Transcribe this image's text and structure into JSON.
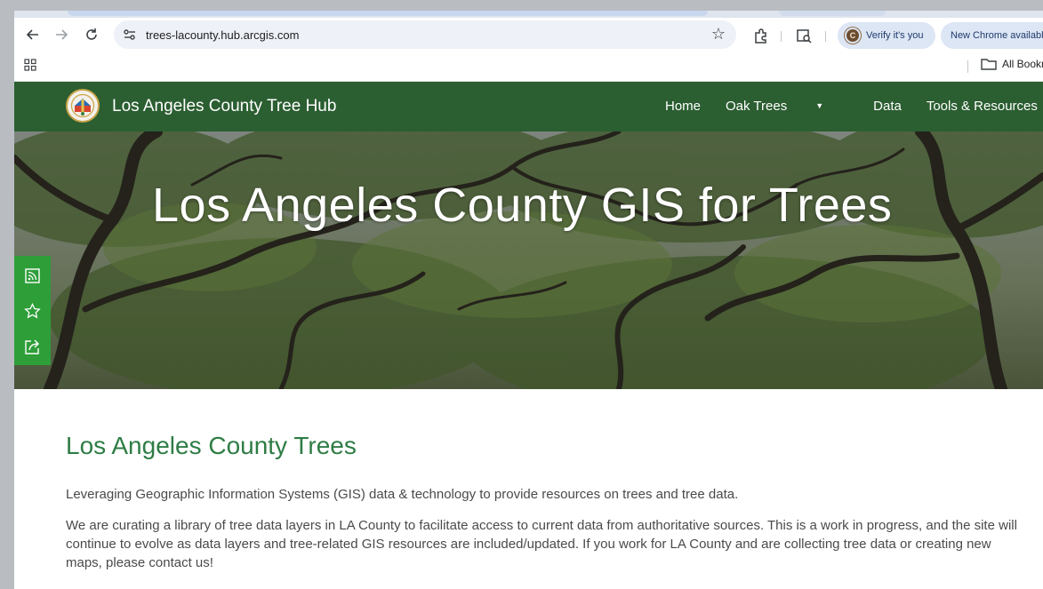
{
  "browser": {
    "url": "trees-lacounty.hub.arcgis.com",
    "verify_chip": "Verify it's you",
    "verify_icon_letter": "C",
    "update_chip": "New Chrome availabl",
    "bookmarks_label": "All Bookm"
  },
  "site": {
    "title": "Los Angeles County Tree Hub",
    "nav": {
      "home": "Home",
      "oak_trees": "Oak Trees",
      "data": "Data",
      "tools": "Tools & Resources"
    },
    "hero_title": "Los Angeles County GIS for Trees"
  },
  "content": {
    "heading": "Los Angeles County Trees",
    "intro": "Leveraging Geographic Information Systems (GIS) data & technology to provide resources on trees and tree data.",
    "body": "We are curating a library of tree data layers in LA County to facilitate access to current data from authoritative sources. This is a work in progress, and the site will continue to evolve as data layers and tree-related GIS resources are included/updated. If you work for LA County and are collecting tree data or creating new maps, please contact us!"
  },
  "colors": {
    "header_green": "#2b5e31",
    "accent_green": "#2e7d45",
    "side_tools_green": "#2e9e39"
  },
  "icons": [
    "back-arrow-icon",
    "forward-arrow-icon",
    "reload-icon",
    "site-settings-icon",
    "bookmark-star-icon",
    "extensions-icon",
    "reading-list-icon",
    "apps-grid-icon",
    "folder-icon",
    "county-seal-icon",
    "caret-down-icon",
    "rss-feed-icon",
    "favorite-star-icon",
    "share-icon"
  ]
}
